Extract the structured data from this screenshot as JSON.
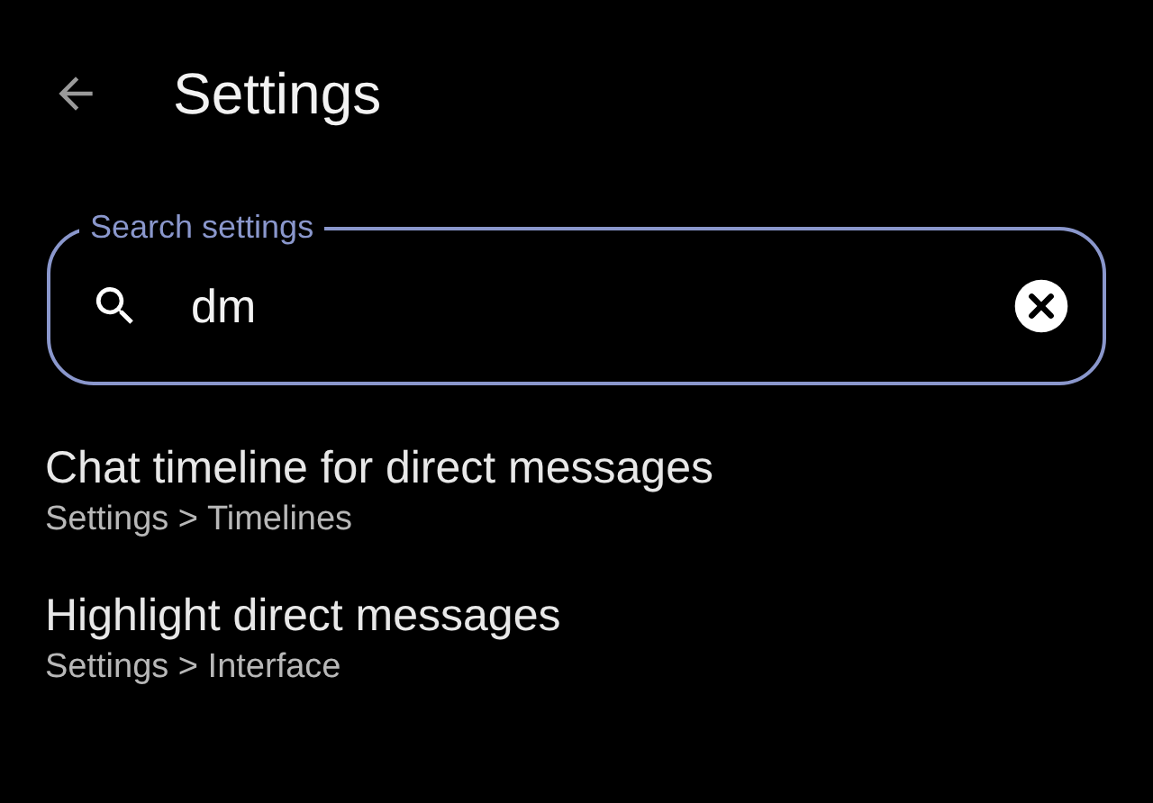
{
  "app_bar": {
    "title": "Settings"
  },
  "search": {
    "label": "Search settings",
    "value": "dm"
  },
  "results": [
    {
      "title": "Chat timeline for direct messages",
      "path": "Settings > Timelines"
    },
    {
      "title": "Highlight direct messages",
      "path": "Settings > Interface"
    }
  ]
}
